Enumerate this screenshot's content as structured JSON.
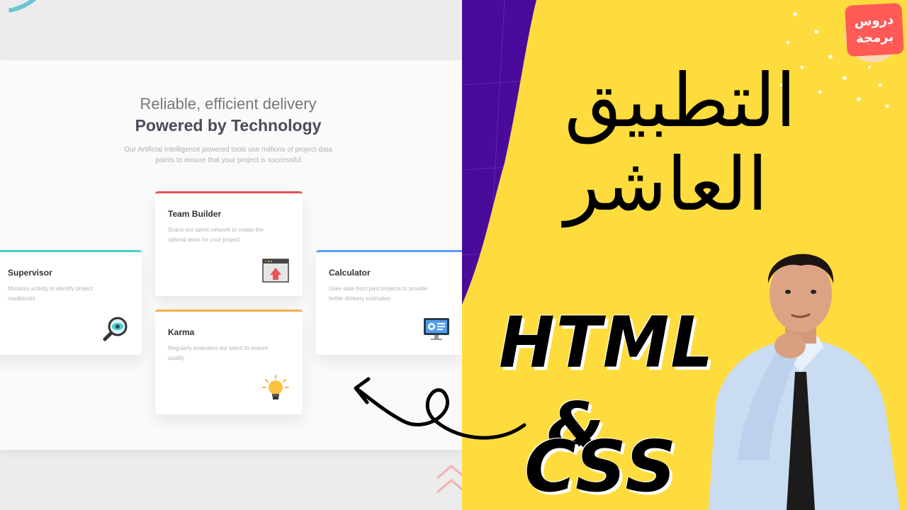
{
  "website": {
    "hero_subtitle": "Reliable, efficient delivery",
    "hero_title": "Powered by Technology",
    "hero_description": "Our Artificial Intelligence powered tools use millions of project data points to ensure that your project is successful",
    "cards": [
      {
        "title": "Supervisor",
        "description": "Monitors activity to identify project roadblocks",
        "icon": "magnifier-eye-icon",
        "accent": "#45d3c7"
      },
      {
        "title": "Team Builder",
        "description": "Scans our talent network to create the optimal team for your project",
        "icon": "browser-upload-icon",
        "accent": "#ea5454"
      },
      {
        "title": "Karma",
        "description": "Regularly evaluates our talent to ensure quality",
        "icon": "lightbulb-icon",
        "accent": "#fcae4a"
      },
      {
        "title": "Calculator",
        "description": "Uses data from past projects to provide better delivery estimates",
        "icon": "monitor-dashboard-icon",
        "accent": "#549ef2"
      }
    ]
  },
  "thumbnail": {
    "badge_line1": "دروس",
    "badge_line2": "برمجة",
    "title_line1": "التطبيق",
    "title_line2": "العاشر",
    "tech_html": "HTML",
    "tech_amp": "&",
    "tech_css": "CSS",
    "colors": {
      "yellow": "#fedc3e",
      "purple": "#4a0a9a",
      "badge_red": "#ff5a55"
    }
  }
}
